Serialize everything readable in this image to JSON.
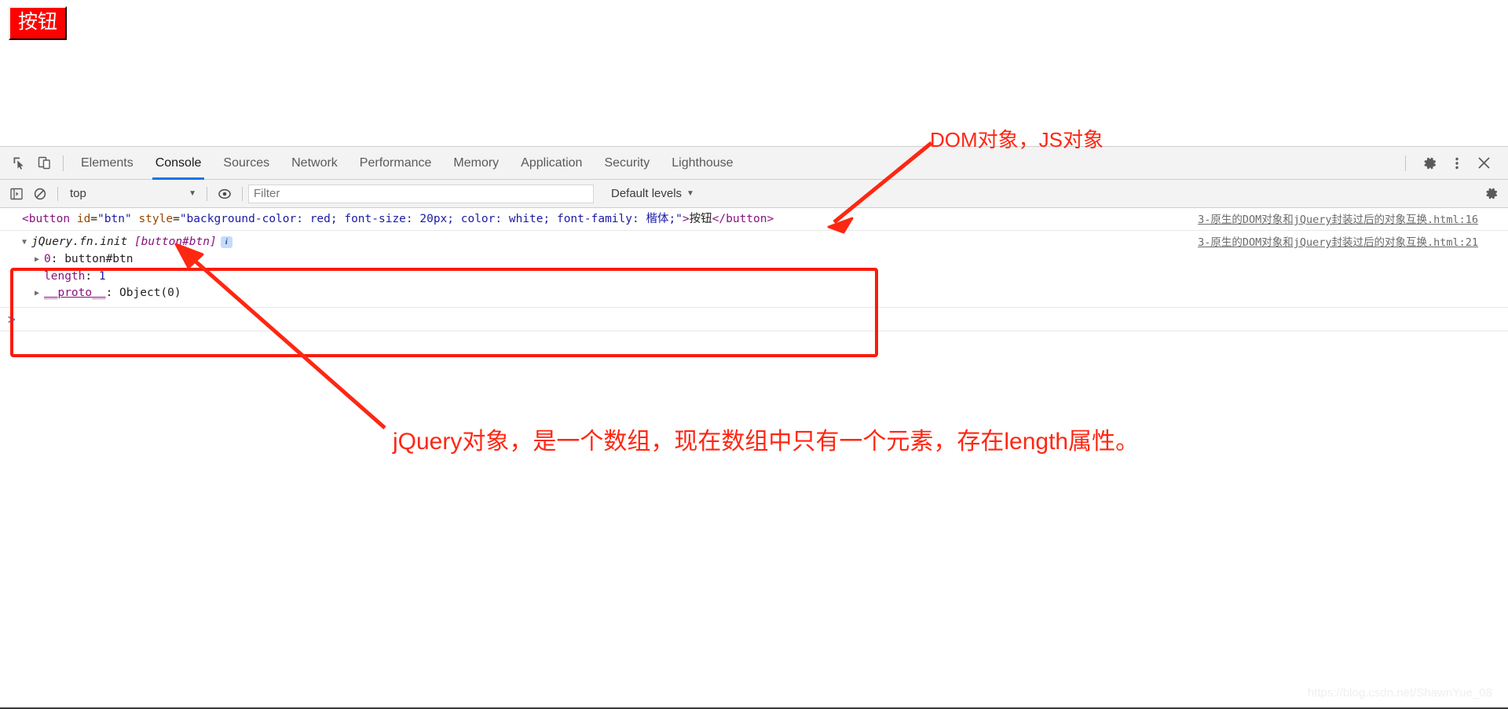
{
  "page": {
    "demo_button_label": "按钮"
  },
  "devtools": {
    "left_icons": [
      {
        "name": "inspect-element-icon",
        "glyph": "inspect"
      },
      {
        "name": "device-toolbar-icon",
        "glyph": "device"
      }
    ],
    "tabs": [
      {
        "label": "Elements",
        "active": false
      },
      {
        "label": "Console",
        "active": true
      },
      {
        "label": "Sources",
        "active": false
      },
      {
        "label": "Network",
        "active": false
      },
      {
        "label": "Performance",
        "active": false
      },
      {
        "label": "Memory",
        "active": false
      },
      {
        "label": "Application",
        "active": false
      },
      {
        "label": "Security",
        "active": false
      },
      {
        "label": "Lighthouse",
        "active": false
      }
    ],
    "right_icons": [
      {
        "name": "settings-gear-icon"
      },
      {
        "name": "more-options-icon"
      },
      {
        "name": "close-devtools-icon"
      }
    ],
    "filterbar": {
      "sidebar_toggle_name": "console-sidebar-icon",
      "clear_console_name": "clear-console-icon",
      "context_value": "top",
      "eye_icon_name": "live-expression-icon",
      "filter_placeholder": "Filter",
      "filter_value": "",
      "levels_label": "Default levels",
      "settings_icon_name": "console-settings-icon"
    }
  },
  "console": {
    "rows": [
      {
        "type": "html-echo",
        "source_link": "3-原生的DOM对象和jQuery封装过后的对象互换.html:16",
        "tokens": [
          {
            "cls": "tok-tag",
            "t": "<button"
          },
          {
            "cls": "tok-plain",
            "t": " "
          },
          {
            "cls": "tok-attr",
            "t": "id"
          },
          {
            "cls": "tok-plain",
            "t": "="
          },
          {
            "cls": "tok-val",
            "t": "\"btn\""
          },
          {
            "cls": "tok-plain",
            "t": " "
          },
          {
            "cls": "tok-attr",
            "t": "style"
          },
          {
            "cls": "tok-plain",
            "t": "="
          },
          {
            "cls": "tok-val",
            "t": "\"background-color: red; font-size: 20px; color: white; font-family: 楷体;\""
          },
          {
            "cls": "tok-tag",
            "t": ">"
          },
          {
            "cls": "tok-plain",
            "t": "按钮"
          },
          {
            "cls": "tok-tag",
            "t": "</button>"
          }
        ]
      },
      {
        "type": "object",
        "source_link": "3-原生的DOM对象和jQuery封装过后的对象互换.html:21",
        "disclosure": "▼",
        "class_name": "jQuery.fn.init",
        "preview": "[button#btn]",
        "info_badge": "i",
        "props": [
          {
            "disclosure": "▶",
            "key": "0",
            "sep": ": ",
            "value": "button#btn",
            "value_kind": "obj"
          },
          {
            "disclosure": "",
            "key": "length",
            "sep": ": ",
            "value": "1",
            "value_kind": "num"
          },
          {
            "disclosure": "▶",
            "key": "__proto__",
            "sep": ": ",
            "value": "Object(0)",
            "value_kind": "obj",
            "underline": true
          }
        ]
      }
    ],
    "prompt_caret": ">"
  },
  "annotations": [
    {
      "id": "annot-dom",
      "text": "DOM对象，JS对象"
    },
    {
      "id": "annot-jq",
      "text": "jQuery对象，是一个数组，现在数组中只有一个元素，存在length属性。"
    }
  ],
  "watermark": "https://blog.csdn.net/ShawnYue_08",
  "colors": {
    "annotation_red": "#fe2712",
    "box_red": "#fb1b0a",
    "active_tab_blue": "#1a73e8",
    "demo_button_bg": "#ff0000"
  }
}
